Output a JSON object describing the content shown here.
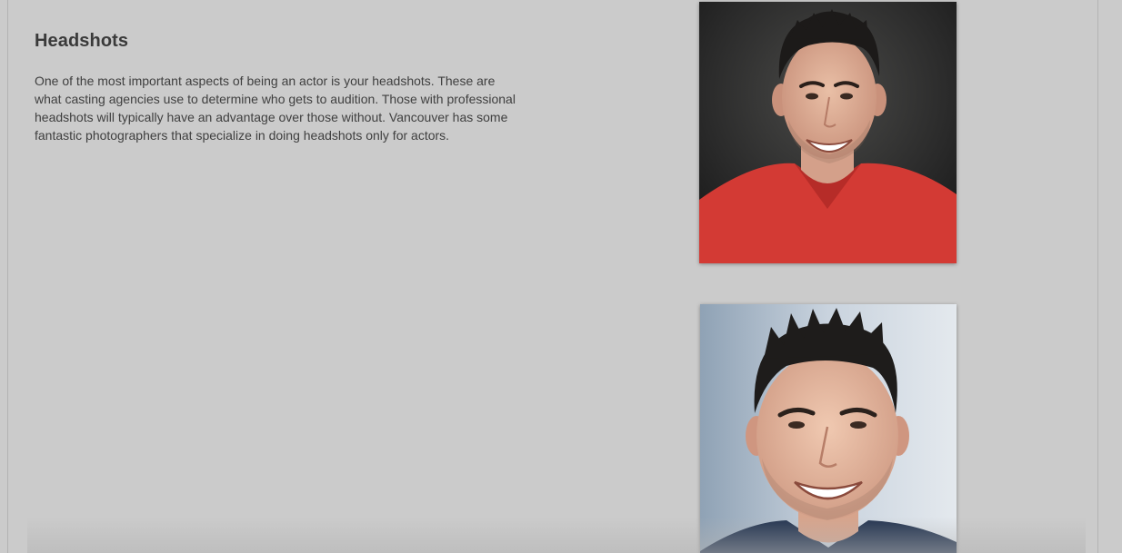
{
  "section": {
    "heading": "Headshots",
    "paragraph": "One of the most important aspects of being an actor is your headshots. These are what casting agencies use to determine who gets to audition. Those with professional headshots will typically have an advantage over those without. Vancouver has some fantastic photographers that specialize in doing headshots only for actors."
  },
  "photos": [
    {
      "subject": "headshot-red-shirt",
      "shirt_color": "#d33a34",
      "background_color": "#2b2b2b"
    },
    {
      "subject": "headshot-navy-shirt",
      "shirt_color": "#22334f",
      "background_color": "#c8d2dd"
    }
  ]
}
